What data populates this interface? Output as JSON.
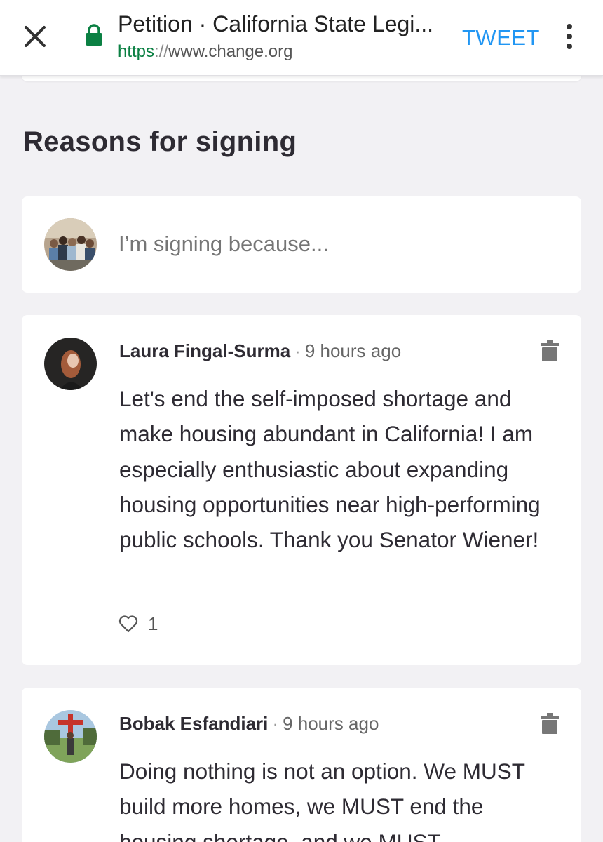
{
  "browser": {
    "page_title": "Petition · California State Legi...",
    "url_scheme": "https",
    "url_separator": "://",
    "url_host": "www.change.org",
    "tweet_label": "TWEET"
  },
  "reasons": {
    "title": "Reasons for signing",
    "compose_placeholder": "I’m signing because...",
    "comments": [
      {
        "author": "Laura Fingal-Surma",
        "separator": "·",
        "time": "9 hours ago",
        "text": "Let's end the self-imposed shortage and make housing abundant in California! I am especially enthusiastic about expanding housing opportunities near high-performing public schools. Thank you Senator Wiener!",
        "likes": "1"
      },
      {
        "author": "Bobak Esfandiari",
        "separator": "·",
        "time": "9 hours ago",
        "text": "Doing nothing is not an option. We MUST build more homes, we MUST end the housing shortage, and we MUST"
      }
    ]
  },
  "colors": {
    "tweet_blue": "#2196f3",
    "secure_green": "#0b8043",
    "page_background": "#f2f1f4"
  },
  "icons": [
    "close-icon",
    "lock-icon",
    "more-vert-icon",
    "trash-icon",
    "heart-icon"
  ]
}
